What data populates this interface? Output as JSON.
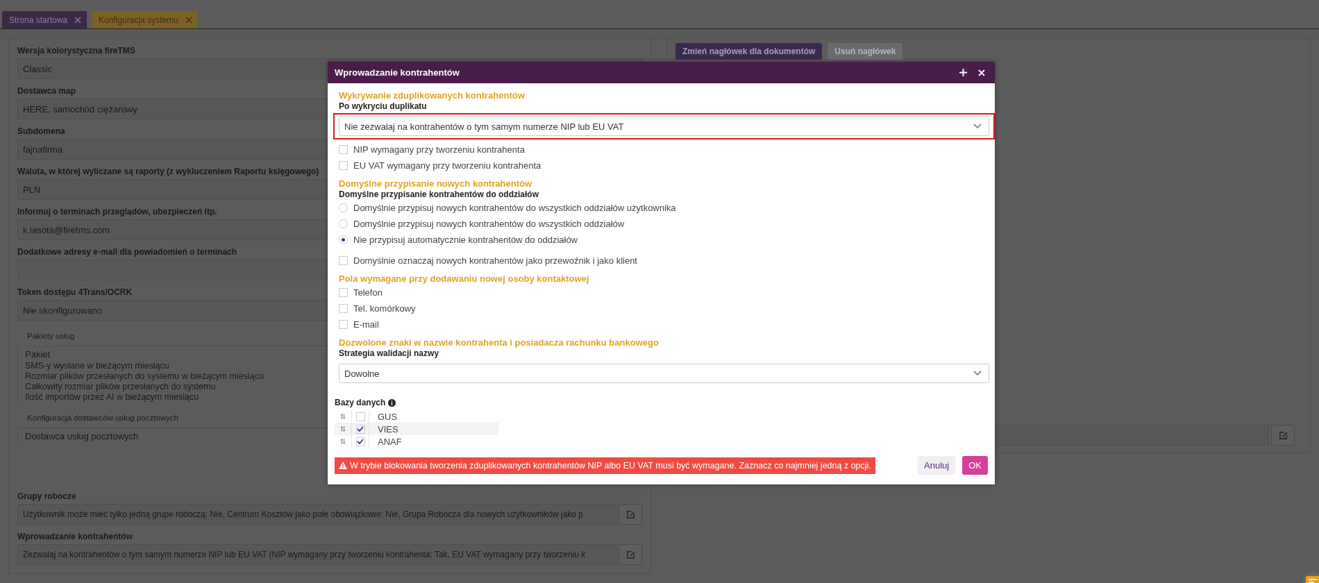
{
  "tabs": [
    {
      "label": "Strona startowa",
      "selected": false
    },
    {
      "label": "Konfiguracja systemu",
      "selected": true
    }
  ],
  "settings": [
    {
      "label": "Wersja kolorystyczna fireTMS",
      "value": "Classic"
    },
    {
      "label": "Dostawca map",
      "value": "HERE, samochód ciężarowy"
    },
    {
      "label": "Subdomena",
      "value": "fajnafirma"
    },
    {
      "label": "Waluta, w której wyliczane są raporty (z wykluczeniem Raportu księgowego)",
      "value": "PLN"
    },
    {
      "label": "Informuj o terminach przeglądów, ubezpieczeń itp.",
      "value": "k.lasota@firetms.com"
    },
    {
      "label": "Dodatkowe adresy e-mail dla powiadomień o terminach"
    },
    {
      "label": "Token dostępu 4Trans/OCRK",
      "value": "Nie skonfigurowano"
    }
  ],
  "packages": {
    "title": "Pakiety usług",
    "header": "Pakiet",
    "rows": [
      "SMS-y wysłane w bieżącym miesiącu",
      "Rozmiar plików przesłanych do systemu w bieżącym miesiącu",
      "Całkowity rozmiar plików przesłanych do systemu",
      "Ilość importów przez AI w bieżącym miesiącu"
    ]
  },
  "postal": {
    "title": "Konfiguracja dostawców usług pocztowych",
    "header": "Dostawca usług pocztowych"
  },
  "bottom_settings": [
    {
      "label": "Grupy robocze",
      "value": "Użytkownik może mieć tylko jedną grupe roboczą: Nie, Centrum Kosztów jako pole obowiązkowe: Nie, Grupa Robocza dla nowych użytkowników jako p",
      "editable": true
    },
    {
      "label": "Wprowadzanie kontrahentów",
      "value": "Zezwalaj na kontrahentów o tym samym numerze NIP lub EU VAT (NIP wymagany przy tworzeniu kontrahenta: Tak, EU VAT wymagany przy tworzeniu k",
      "editable": true
    }
  ],
  "right_panel": {
    "buttons": [
      {
        "label": "Zmień nagłówek dla dokumentów",
        "disabled": false
      },
      {
        "label": "Usuń nagłówek",
        "disabled": true
      }
    ]
  },
  "dialog": {
    "title": "Wprowadzanie kontrahentów",
    "items": [
      {
        "kind": "heading",
        "text": "Wykrywanie zduplikowanych kontrahentów"
      },
      {
        "kind": "label",
        "text": "Po wykryciu duplikatu"
      },
      {
        "kind": "select",
        "value": "Nie zezwalaj na kontrahentów o tym samym numerze NIP lub EU VAT",
        "invalid": true
      },
      {
        "kind": "checkbox",
        "text": "NIP wymagany przy tworzeniu kontrahenta",
        "checked": false
      },
      {
        "kind": "checkbox",
        "text": "EU VAT wymagany przy tworzeniu kontrahenta",
        "checked": false
      },
      {
        "kind": "heading",
        "text": "Domyślne przypisanie nowych kontrahentów"
      },
      {
        "kind": "label",
        "text": "Domyślne przypisanie kontrahentów do oddziałów"
      },
      {
        "kind": "radio",
        "text": "Domyślnie przypisuj nowych kontrahentów do wszystkich oddziałów użytkownika",
        "selected": false
      },
      {
        "kind": "radio",
        "text": "Domyślnie przypisuj nowych kontrahentów do wszystkich oddziałów",
        "selected": false
      },
      {
        "kind": "radio",
        "text": "Nie przypisuj automatycznie kontrahentów do oddziałów",
        "selected": true
      },
      {
        "kind": "checkbox",
        "text": "Domyślnie oznaczaj nowych kontrahentów jako przewoźnik i jako klient",
        "checked": false
      },
      {
        "kind": "heading",
        "text": "Pola wymagane przy dodawaniu nowej osoby kontaktowej"
      },
      {
        "kind": "checkbox",
        "text": "Telefon",
        "checked": false
      },
      {
        "kind": "checkbox",
        "text": "Tel. komórkowy",
        "checked": false
      },
      {
        "kind": "checkbox",
        "text": "E-mail",
        "checked": false
      },
      {
        "kind": "heading",
        "text": "Dozwolone znaki w nazwie kontrahenta i posiadacza rachunku bankowego"
      },
      {
        "kind": "label",
        "text": "Strategia walidacji nazwy"
      },
      {
        "kind": "select",
        "value": "Dowolne",
        "invalid": false
      }
    ],
    "databases": {
      "label": "Bazy danych",
      "rows": [
        {
          "name": "GUS",
          "checked": false,
          "selected": false
        },
        {
          "name": "VIES",
          "checked": true,
          "selected": true
        },
        {
          "name": "ANAF",
          "checked": true,
          "selected": false
        }
      ]
    },
    "error": "W trybie blokowania tworzenia zduplikowanych kontrahentów NIP albo EU VAT musi być wymagane. Zaznacz co najmniej jedną z opcji.",
    "buttons": [
      {
        "label": "Anuluj",
        "kind": "secondary"
      },
      {
        "label": "OK",
        "kind": "primary"
      }
    ]
  }
}
